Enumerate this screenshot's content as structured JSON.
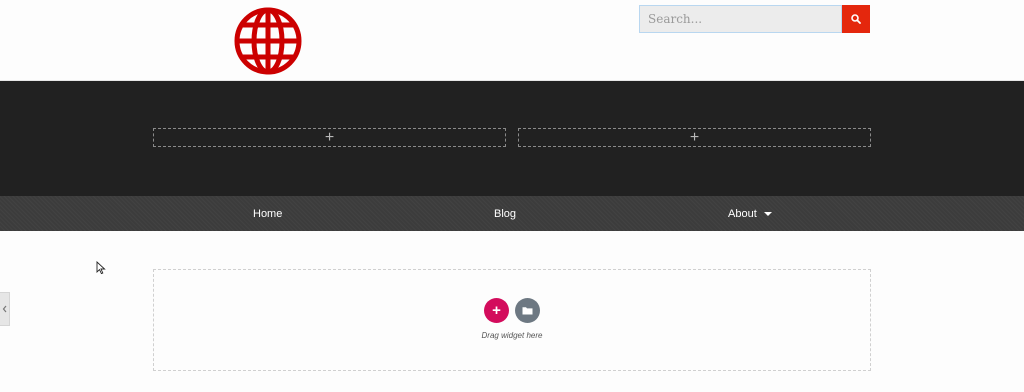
{
  "header": {
    "logo_icon": "globe-icon",
    "logo_color": "#cc0000"
  },
  "search": {
    "placeholder": "Search...",
    "button_icon": "search-icon",
    "button_color": "#e4270d"
  },
  "widget_area": {
    "add_icon": "plus-icon"
  },
  "nav": {
    "items": [
      {
        "label": "Home"
      },
      {
        "label": "Blog"
      },
      {
        "label": "About",
        "icon": "chevron-down-icon"
      }
    ]
  },
  "content": {
    "add_button_icon": "plus-icon",
    "add_button_color": "#d30c5c",
    "template_button_icon": "folder-icon",
    "template_button_color": "#6d7882",
    "drag_text": "Drag widget here"
  },
  "side_panel": {
    "toggle_icon": "chevron-left-icon"
  }
}
